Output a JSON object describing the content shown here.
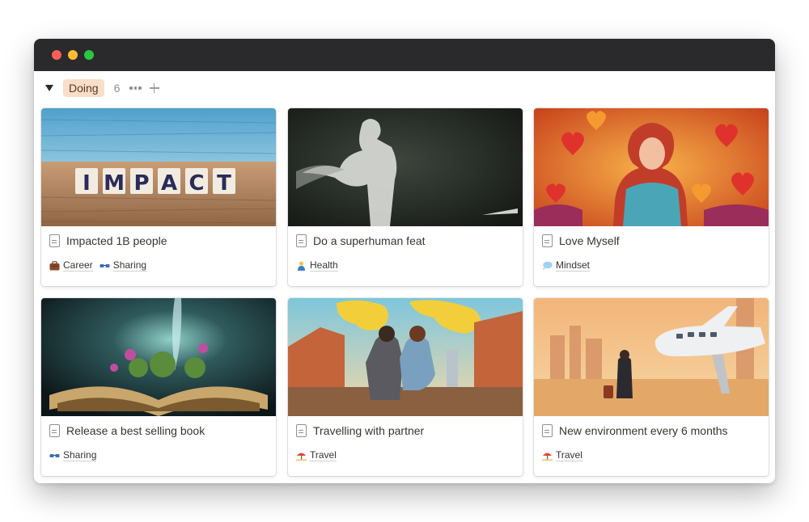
{
  "group": {
    "status": "Doing",
    "count": "6"
  },
  "cards": [
    {
      "title": "Impacted 1B people",
      "cover_text": "IMPACT",
      "tags": [
        {
          "label": "Career",
          "icon": "briefcase-icon"
        },
        {
          "label": "Sharing",
          "icon": "glasses-icon"
        }
      ]
    },
    {
      "title": "Do a superhuman feat",
      "tags": [
        {
          "label": "Health",
          "icon": "person-icon"
        }
      ]
    },
    {
      "title": "Love Myself",
      "tags": [
        {
          "label": "Mindset",
          "icon": "speech-bubble-icon"
        }
      ]
    },
    {
      "title": "Release a best selling book",
      "tags": [
        {
          "label": "Sharing",
          "icon": "glasses-icon"
        }
      ]
    },
    {
      "title": "Travelling with partner",
      "tags": [
        {
          "label": "Travel",
          "icon": "beach-umbrella-icon"
        }
      ]
    },
    {
      "title": "New environment every 6 months",
      "tags": [
        {
          "label": "Travel",
          "icon": "beach-umbrella-icon"
        }
      ]
    }
  ]
}
